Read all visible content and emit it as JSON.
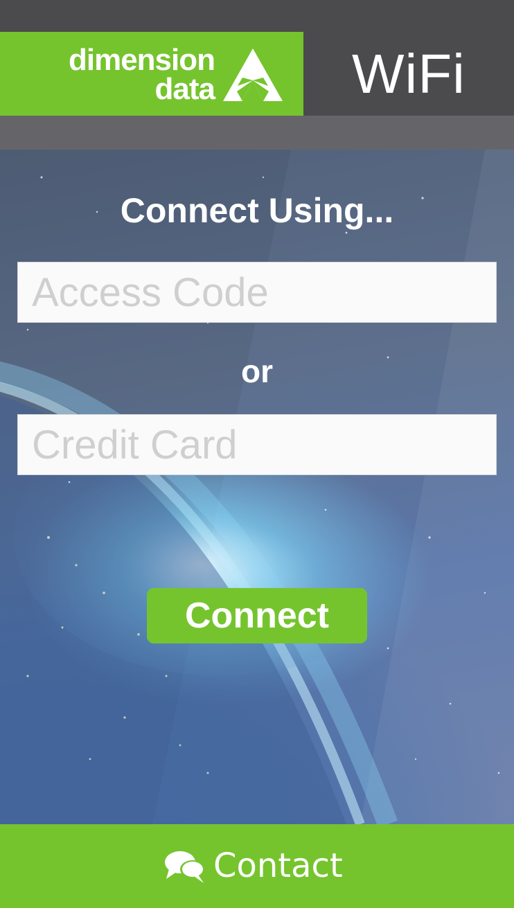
{
  "header": {
    "brand_line1": "dimension",
    "brand_line2": "data",
    "brand_icon": "dimension-data-triangle-logo",
    "title": "WiFi"
  },
  "main": {
    "heading": "Connect Using...",
    "access_code": {
      "value": "",
      "placeholder": "Access Code"
    },
    "separator": "or",
    "credit_card": {
      "value": "",
      "placeholder": "Credit Card"
    },
    "connect_label": "Connect"
  },
  "footer": {
    "contact_icon": "chat-bubbles-icon",
    "contact_label": "Contact"
  },
  "colors": {
    "accent_green": "#75c42e",
    "header_dark": "#4b4b4d",
    "subbar_gray": "#656569",
    "input_background": "#fafafa",
    "placeholder_text": "#cfcfcf"
  }
}
